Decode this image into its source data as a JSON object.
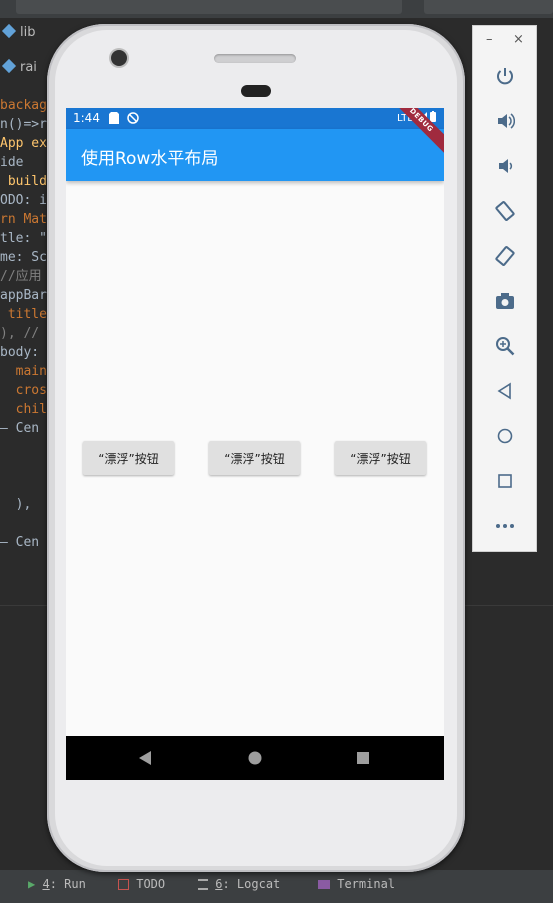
{
  "ide": {
    "breadcrumb_label": "lib",
    "file_label": "rai",
    "code_lines": [
      "backage",
      "n()=>ru",
      "App ext",
      "ide",
      " build(",
      "ODO: in",
      "rn Mate",
      "tle: \"",
      "me: Sca",
      "//应用",
      "appBar:",
      " title",
      "), // ",
      "body: ",
      "  main",
      "  cros",
      "  chil",
      "— Cen",
      "",
      "",
      "",
      "  ),",
      "",
      "— Cen"
    ],
    "bottom_items": [
      {
        "key": "4",
        "label": ": Run"
      },
      {
        "key": "",
        "label": "TODO"
      },
      {
        "key": "6",
        "label": ": Logcat"
      },
      {
        "key": "",
        "label": "Terminal"
      }
    ]
  },
  "emulator": {
    "window_controls": [
      "–",
      "×"
    ],
    "buttons": [
      "power-icon",
      "volume-up-icon",
      "volume-down-icon",
      "rotate-left-icon",
      "rotate-right-icon",
      "camera-icon",
      "zoom-icon",
      "back-icon",
      "home-icon",
      "overview-icon",
      "more-icon"
    ]
  },
  "phone": {
    "status_time": "1:44",
    "status_network": "LTE",
    "debug_label": "DEBUG",
    "app_title": "使用Row水平布局",
    "buttons": [
      "“漂浮”按钮",
      "“漂浮”按钮",
      "“漂浮”按钮"
    ]
  },
  "colors": {
    "status_bar": "#1976d2",
    "app_bar": "#2196f3",
    "button_bg": "#e0e0e0"
  }
}
